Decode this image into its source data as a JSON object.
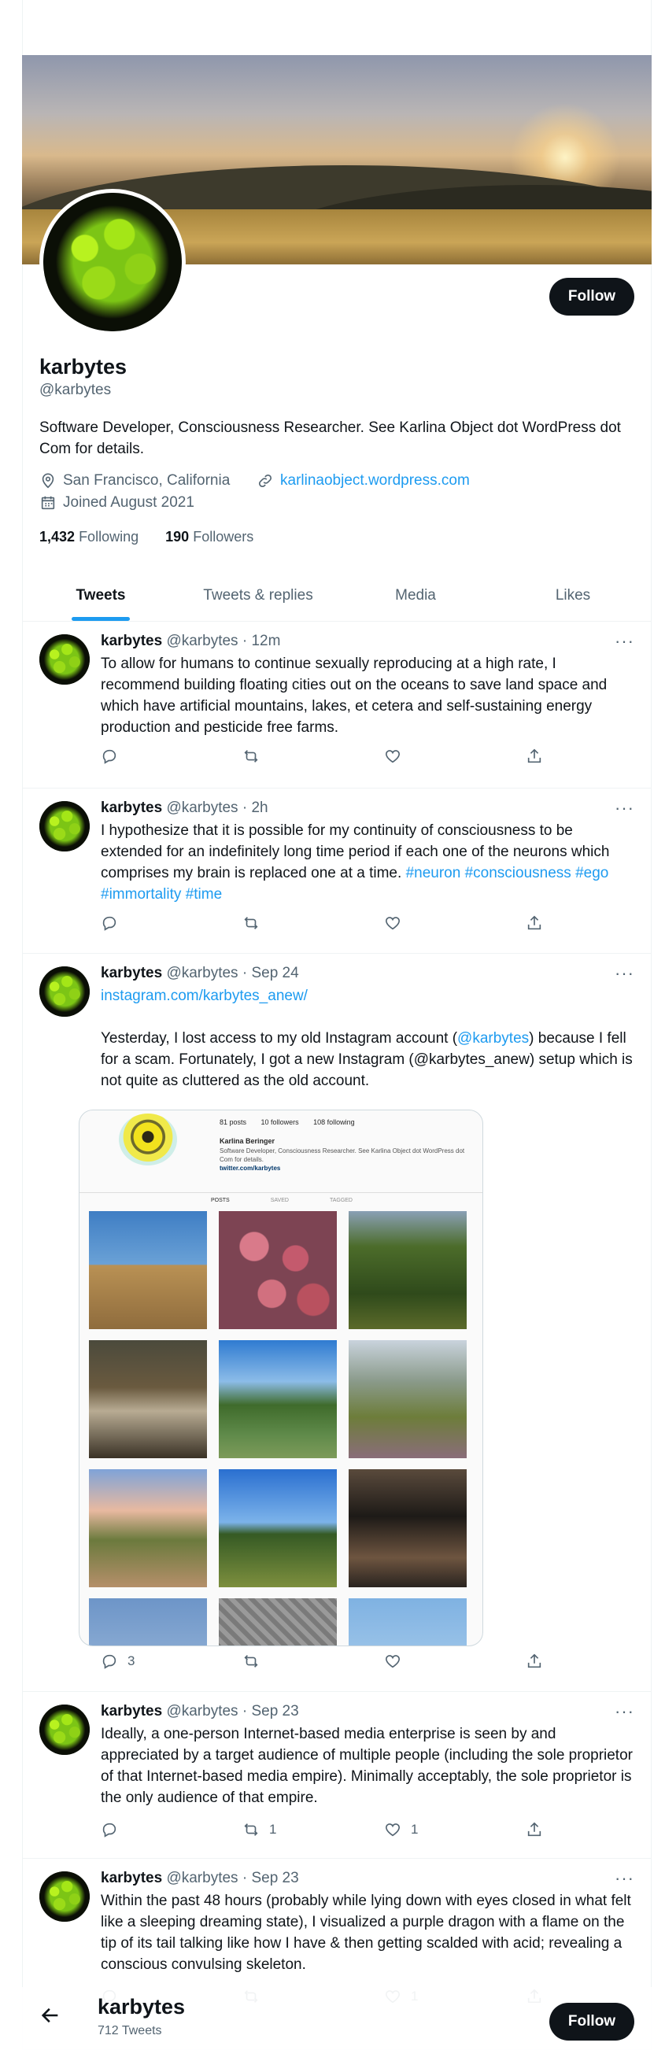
{
  "profile": {
    "name": "karbytes",
    "handle": "@karbytes",
    "bio": "Software Developer, Consciousness Researcher. See Karlina Object dot WordPress dot Com for details.",
    "location": "San Francisco, California",
    "website": "karlinaobject.wordpress.com",
    "joined": "Joined August 2021",
    "following_count": "1,432",
    "following_label": "Following",
    "followers_count": "190",
    "followers_label": "Followers",
    "follow_label": "Follow",
    "tweet_count": "712 Tweets"
  },
  "tabs": [
    "Tweets",
    "Tweets & replies",
    "Media",
    "Likes"
  ],
  "tweets": [
    {
      "name": "karbytes",
      "handle": "@karbytes",
      "time": "· 12m",
      "text": "To allow for humans to continue sexually reproducing at a high rate, I recommend building floating cities out on the oceans to save land space and which have artificial mountains, lakes, et cetera and self-sustaining energy production and pesticide free farms.",
      "replies": "",
      "retweets": "",
      "likes": ""
    },
    {
      "name": "karbytes",
      "handle": "@karbytes",
      "time": "· 2h",
      "text": "I hypothesize that it is possible for my continuity of consciousness to be extended for an indefinitely long time period if each one of the neurons which comprises my brain is replaced one at a time.",
      "hashtag_1": "#neuron",
      "hashtag_2": "#consciousness",
      "hashtag_3": "#ego",
      "hashtag_4": "#immortality",
      "hashtag_5": "#time",
      "replies": "",
      "retweets": "",
      "likes": ""
    },
    {
      "name": "karbytes",
      "handle": "@karbytes",
      "time": "· Sep 24",
      "link": "instagram.com/karbytes_anew/",
      "text_a": "Yesterday, I lost access to my old Instagram account (",
      "mention": "@karbytes",
      "text_b": ") because I fell for a scam. Fortunately, I got a new Instagram (@karbytes_anew) setup which is not quite as cluttered as the old account.",
      "replies": "3",
      "retweets": "",
      "likes": ""
    },
    {
      "name": "karbytes",
      "handle": "@karbytes",
      "time": "· Sep 23",
      "text": "Ideally, a one-person Internet-based media enterprise is seen by and appreciated by a target audience of multiple people (including the sole proprietor of that Internet-based media empire). Minimally acceptably, the sole proprietor is the only audience of that empire.",
      "replies": "",
      "retweets": "1",
      "likes": "1"
    },
    {
      "name": "karbytes",
      "handle": "@karbytes",
      "time": "· Sep 23",
      "text": "Within the past 48 hours (probably while lying down with eyes closed in what felt like a sleeping dreaming state), I visualized a purple dragon with a flame on the tip of its tail talking like how I have & then getting scalded with acid; revealing a conscious convulsing skeleton.",
      "replies": "",
      "retweets": "",
      "likes": "1"
    }
  ],
  "instagram_card": {
    "posts": "81 posts",
    "followers": "10 followers",
    "following": "108 following",
    "name": "Karlina Beringer",
    "bio": "Software Developer, Consciousness Researcher. See Karlina Object dot WordPress dot Com for details.",
    "link": "twitter.com/karbytes",
    "tab_posts": "POSTS",
    "tab_saved": "SAVED",
    "tab_tagged": "TAGGED"
  },
  "icons": {
    "more": "more-icon",
    "reply": "reply-icon",
    "retweet": "retweet-icon",
    "like": "heart-icon",
    "share": "share-icon",
    "location": "location-icon",
    "link": "link-icon",
    "calendar": "calendar-icon",
    "back": "back-arrow-icon"
  },
  "colors": {
    "accent": "#1d9bf0",
    "text": "#0f1419",
    "muted": "#536471",
    "button": "#0f1419"
  }
}
